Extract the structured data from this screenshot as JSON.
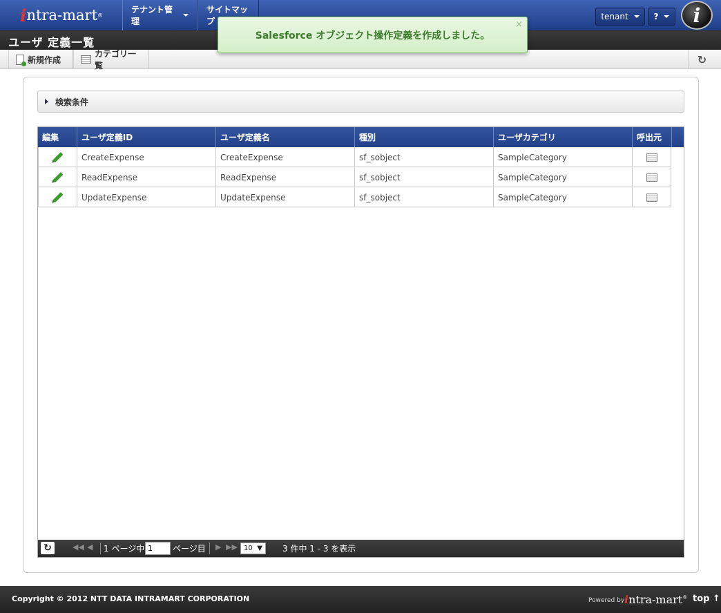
{
  "app": {
    "logo_i": "i",
    "logo_text": "ntra-mart",
    "logo_reg": "®"
  },
  "nav": {
    "tenant_menu": "テナント管理",
    "sitemap": "サイトマップ",
    "user_menu": "tenant",
    "help_menu": "?"
  },
  "flash": {
    "message": "Salesforce オブジェクト操作定義を作成しました。",
    "close": "×",
    "color": "#3e7a2e"
  },
  "page": {
    "title": "ユーザ 定義一覧"
  },
  "toolbar": {
    "new_label": "新規作成",
    "category_label": "カテゴリ一覧",
    "refresh_icon": "refresh-icon"
  },
  "search": {
    "label": "検索条件"
  },
  "grid": {
    "columns": [
      "編集",
      "ユーザ定義ID",
      "ユーザ定義名",
      "種別",
      "ユーザカテゴリ",
      "呼出元"
    ],
    "rows": [
      {
        "id": "CreateExpense",
        "name": "CreateExpense",
        "type": "sf_sobject",
        "category": "SampleCategory"
      },
      {
        "id": "ReadExpense",
        "name": "ReadExpense",
        "type": "sf_sobject",
        "category": "SampleCategory"
      },
      {
        "id": "UpdateExpense",
        "name": "UpdateExpense",
        "type": "sf_sobject",
        "category": "SampleCategory"
      }
    ],
    "header_color": "#2b4a94"
  },
  "pager": {
    "first": "◀◀",
    "prev": "◀",
    "page_prefix": "1 ページ中",
    "page_value": "1",
    "page_suffix": "ページ目",
    "next": "▶",
    "last": "▶▶",
    "page_size": "10",
    "page_size_caret": "▼",
    "summary": "3 件中 1 - 3 を表示"
  },
  "footer": {
    "copyright": "Copyright © 2012 NTT DATA INTRAMART CORPORATION",
    "powered_by": "Powered by",
    "powered_logo_i": "i",
    "powered_logo_text": "ntra-mart",
    "powered_logo_reg": "®",
    "top_link": "top ↑"
  }
}
